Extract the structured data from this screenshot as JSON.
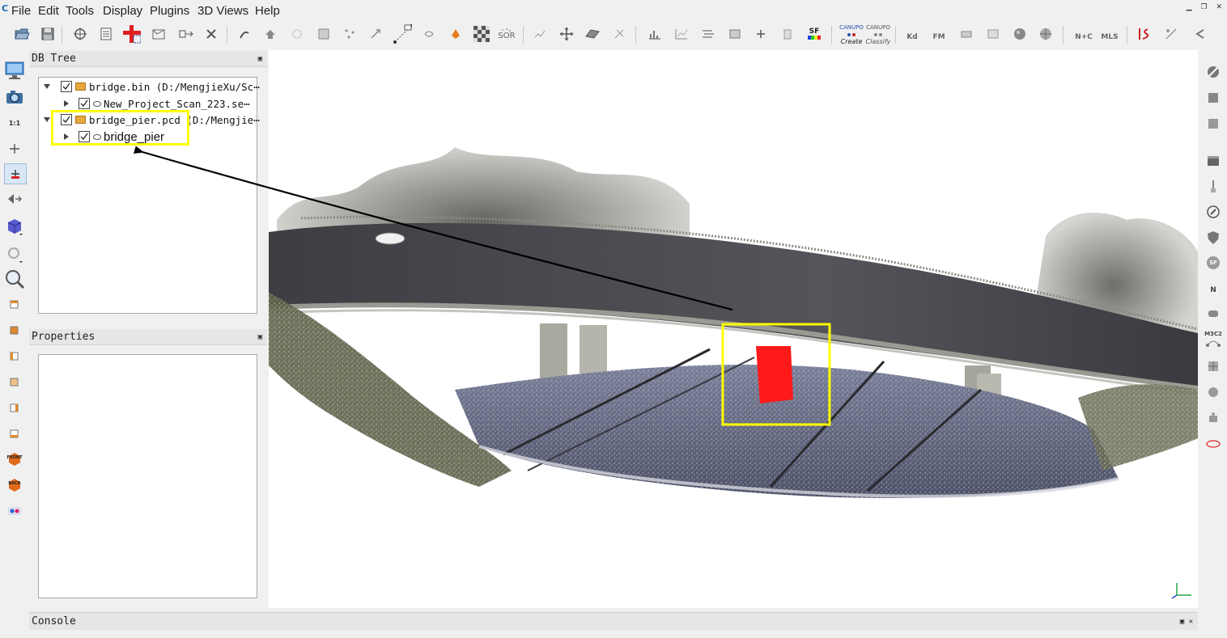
{
  "menu": {
    "items": [
      "File",
      "Edit",
      "Tools",
      "Display",
      "Plugins",
      "3D Views",
      "Help"
    ]
  },
  "toolbar": {
    "sor_label": "SOR",
    "sf_label": "SF",
    "canupo_create_top": "CANUPO",
    "canupo_create_bottom": "Create",
    "canupo_classify_top": "CANUPO",
    "canupo_classify_bottom": "Classify",
    "kd_label": "Kd",
    "fm_label": "FM",
    "nc_label": "N+C",
    "mls_label": "MLS"
  },
  "left_toolbar": {
    "scale_label": "1:1",
    "front_label": "FRONT",
    "back_label": "BACK"
  },
  "right_toolbar": {
    "sf_label": "SF",
    "n_label": "N",
    "m3c2_label": "M3C2"
  },
  "db_tree": {
    "title": "DB Tree",
    "items": [
      {
        "label": "bridge.bin (D:/MengjieXu/Sc⋯",
        "level": 0,
        "expanded": true,
        "checked": true,
        "type": "file"
      },
      {
        "label": "New_Project_Scan_223.se⋯",
        "level": 1,
        "expanded": false,
        "checked": true,
        "type": "cloud"
      },
      {
        "label": "bridge_pier.pcd (D:/Mengjie⋯",
        "level": 0,
        "expanded": true,
        "checked": true,
        "type": "file"
      },
      {
        "label": "bridge_pier",
        "level": 1,
        "expanded": false,
        "checked": true,
        "type": "cloud"
      }
    ]
  },
  "properties": {
    "title": "Properties"
  },
  "console": {
    "title": "Console"
  },
  "colors": {
    "highlight": "#ffff00",
    "selection_fill": "#ff1a1a",
    "arrow": "#000000"
  }
}
